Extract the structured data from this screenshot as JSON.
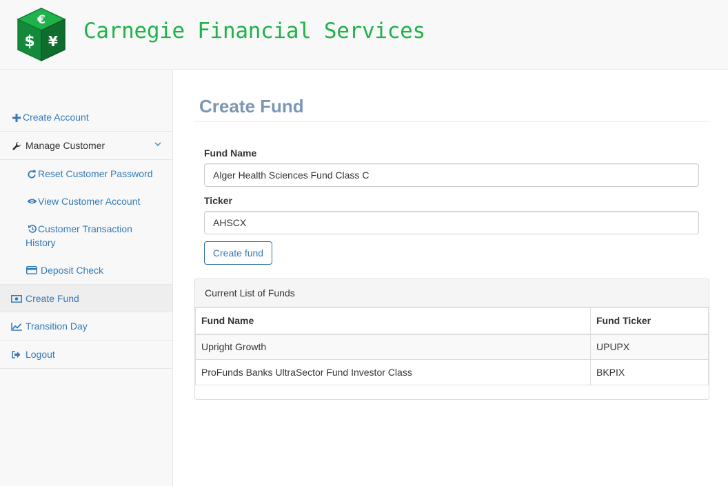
{
  "header": {
    "brand": "Carnegie Financial Services",
    "logo_icon": "currency-cube-icon",
    "logo_glyphs": [
      "€",
      "$",
      "¥"
    ]
  },
  "sidebar": {
    "items": [
      {
        "label": "Create Account",
        "icon": "plus-icon"
      },
      {
        "label": "Manage Customer",
        "icon": "wrench-icon",
        "expanded": true,
        "children": [
          {
            "label": "Reset Customer Password",
            "icon": "refresh-icon"
          },
          {
            "label": "View Customer Account",
            "icon": "eye-icon"
          },
          {
            "label": "Customer Transaction History",
            "icon": "history-icon"
          },
          {
            "label": "Deposit Check",
            "icon": "credit-card-icon"
          }
        ]
      },
      {
        "label": "Create Fund",
        "icon": "money-icon",
        "active": true
      },
      {
        "label": "Transition Day",
        "icon": "line-chart-icon"
      },
      {
        "label": "Logout",
        "icon": "sign-out-icon"
      }
    ]
  },
  "main": {
    "title": "Create Fund",
    "form": {
      "fund_name_label": "Fund Name",
      "fund_name_value": "Alger Health Sciences Fund Class C",
      "ticker_label": "Ticker",
      "ticker_value": "AHSCX",
      "submit_label": "Create fund"
    },
    "funds_panel": {
      "heading": "Current List of Funds",
      "columns": [
        "Fund Name",
        "Fund Ticker"
      ],
      "rows": [
        [
          "Upright Growth",
          "UPUPX"
        ],
        [
          "ProFunds Banks UltraSector Fund Investor Class",
          "BKPIX"
        ]
      ]
    }
  },
  "colors": {
    "brand_green": "#1fb24a",
    "link_blue": "#337ab7",
    "title_blue_gray": "#7a97b5"
  }
}
